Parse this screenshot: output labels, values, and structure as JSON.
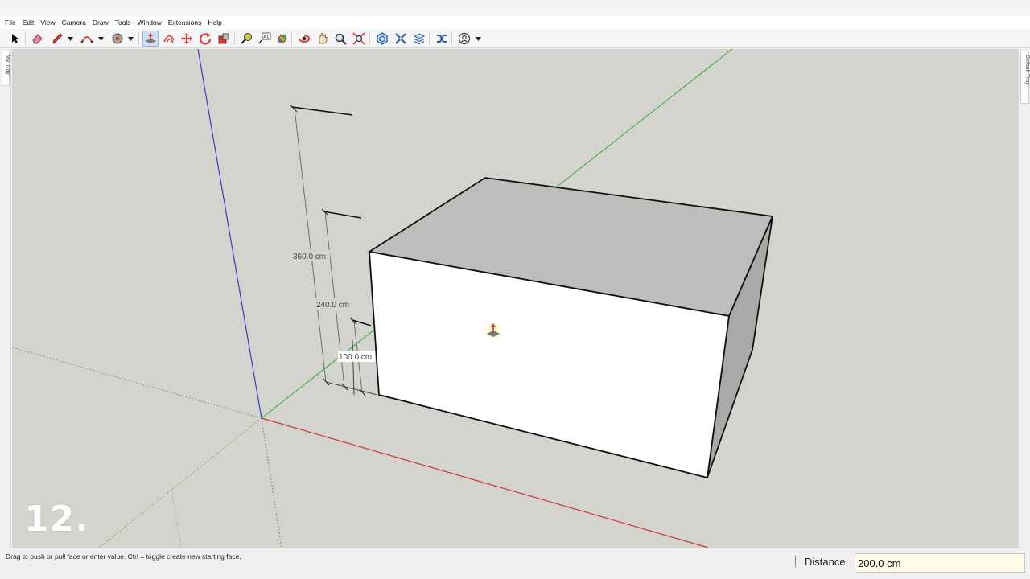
{
  "menu": [
    "File",
    "Edit",
    "View",
    "Camera",
    "Draw",
    "Tools",
    "Window",
    "Extensions",
    "Help"
  ],
  "toolbar": {
    "tools": [
      "select-tool",
      "eraser-tool",
      "pencil-tool",
      "arc-tool",
      "shapes-tool",
      "push-pull-tool",
      "offset-tool",
      "move-tool",
      "rotate-tool",
      "scale-tool",
      "tape-measure-tool",
      "text-tool",
      "paint-bucket-tool",
      "orbit-tool",
      "pan-tool",
      "zoom-tool",
      "zoom-extents-tool",
      "components-tool",
      "materials-tool",
      "styles-tool",
      "layers-tool",
      "account-tool"
    ],
    "active_tool": "push-pull-tool"
  },
  "trays": {
    "left": "My Tray",
    "right": "Default Tray"
  },
  "dimensions": [
    {
      "label": "360.0 cm"
    },
    {
      "label": "240.0 cm"
    },
    {
      "label": "100.0 cm"
    }
  ],
  "step_number": "12.",
  "status": {
    "hint": "Drag to push or pull face or enter value.  Ctrl = toggle create new starting face.",
    "measurement_label": "Distance",
    "measurement_value": "200.0 cm"
  },
  "colors": {
    "viewport_bg": "#d4d4cf",
    "red_axis": "#c43a3a",
    "green_axis": "#3aa83a",
    "blue_axis": "#3b3bcc",
    "vcb_bg": "#fffde8"
  }
}
